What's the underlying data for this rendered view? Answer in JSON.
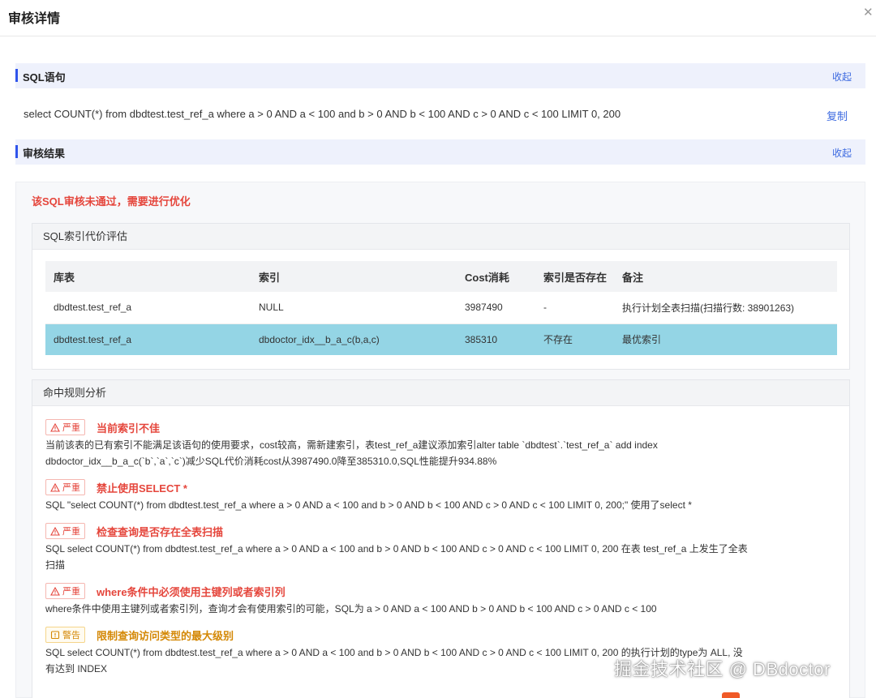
{
  "dialog": {
    "title": "审核详情",
    "close_icon": "close-icon"
  },
  "sql_section": {
    "title": "SQL语句",
    "collapse_label": "收起",
    "sql": "select COUNT(*) from dbdtest.test_ref_a where a > 0 AND a < 100 and b > 0 AND b < 100 AND c > 0 AND c < 100 LIMIT 0, 200",
    "copy_label": "复制"
  },
  "result_section": {
    "title": "审核结果",
    "collapse_label": "收起",
    "fail_message": "该SQL审核未通过，需要进行优化"
  },
  "cost_card": {
    "title": "SQL索引代价评估",
    "columns": [
      "库表",
      "索引",
      "Cost消耗",
      "索引是否存在",
      "备注"
    ],
    "rows": [
      {
        "table": "dbdtest.test_ref_a",
        "index": "NULL",
        "cost": "3987490",
        "exists": "-",
        "note": "执行计划全表扫描(扫描行数: 38901263)"
      },
      {
        "table": "dbdtest.test_ref_a",
        "index": "dbdoctor_idx__b_a_c(b,a,c)",
        "cost": "385310",
        "exists": "不存在",
        "note": "最优索引"
      }
    ],
    "highlight_color": "#94d5e5"
  },
  "rules_card": {
    "title": "命中规则分析",
    "rules": [
      {
        "level": "严重",
        "title": "当前索引不佳",
        "desc_lines": [
          "当前该表的已有索引不能满足该语句的使用要求，cost较高，需新建索引，表test_ref_a建议添加索引alter table `dbdtest`.`test_ref_a` add index",
          "dbdoctor_idx__b_a_c(`b`,`a`,`c`)减少SQL代价消耗cost从3987490.0降至385310.0,SQL性能提升934.88%"
        ]
      },
      {
        "level": "严重",
        "title": "禁止使用SELECT *",
        "desc_lines": [
          "SQL \"select COUNT(*) from dbdtest.test_ref_a where a > 0 AND a < 100 and b > 0 AND b < 100 AND c > 0 AND c < 100 LIMIT 0, 200;\" 使用了select *"
        ]
      },
      {
        "level": "严重",
        "title": "检查查询是否存在全表扫描",
        "desc_lines": [
          "SQL select COUNT(*) from dbdtest.test_ref_a where a > 0 AND a < 100 and b > 0 AND b < 100 AND c > 0 AND c < 100 LIMIT 0, 200 在表 test_ref_a 上发生了全表",
          "扫描"
        ]
      },
      {
        "level": "严重",
        "title": "where条件中必须使用主键列或者索引列",
        "desc_lines": [
          "where条件中使用主键列或者索引列，查询才会有使用索引的可能，SQL为 a > 0 AND a < 100 AND b > 0 AND b < 100 AND c > 0 AND c < 100"
        ]
      },
      {
        "level": "警告",
        "title": "限制查询访问类型的最大级别",
        "desc_lines": [
          "SQL select COUNT(*) from dbdtest.test_ref_a where a > 0 AND a < 100 and b > 0 AND b < 100 AND c > 0 AND c < 100 LIMIT 0, 200 的执行计划的type为 ALL, 没",
          "有达到 INDEX"
        ]
      }
    ]
  },
  "watermark": "掘金技术社区 @ DBdoctor",
  "colors": {
    "accent": "#2f54eb",
    "link": "#3d6ae0",
    "severe": "#e5463c",
    "warning": "#d48806"
  }
}
